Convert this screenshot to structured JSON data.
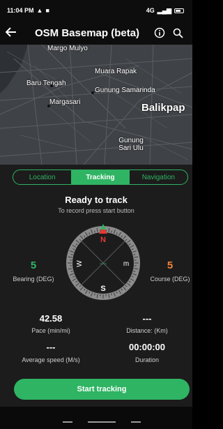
{
  "status_bar": {
    "time": "11:04 PM",
    "network": "4G"
  },
  "app_bar": {
    "back_icon": "arrow-left-icon",
    "title": "OSM Basemap (beta)",
    "info_icon": "info-icon",
    "search_icon": "search-icon"
  },
  "map": {
    "labels": {
      "margo_mulyo": "Margo Mulyo",
      "muara_rapak": "Muara Rapak",
      "baru_tengah": "Baru Tengah",
      "gunung_samarinda": "Gunung Samarinda",
      "margasari": "Margasari",
      "balikpapan": "Balikpap",
      "gunung_sari_ulu": "Gunung Sari Ulu"
    }
  },
  "tabs": [
    {
      "label": "Location",
      "active": false
    },
    {
      "label": "Tracking",
      "active": true
    },
    {
      "label": "Navigation",
      "active": false
    }
  ],
  "tracking": {
    "title": "Ready to track",
    "subtitle": "To record press start button",
    "bearing": {
      "value": "5",
      "label": "Bearing (DEG)",
      "color": "#2fb463"
    },
    "course": {
      "value": "5",
      "label": "Course (DEG)",
      "color": "#f0803c"
    },
    "compass": {
      "north": "N",
      "south": "S",
      "east": "m",
      "west": "W",
      "center": "---",
      "north_color": "#e53935"
    },
    "pace": {
      "value": "42.58",
      "label": "Pace (min/mi)"
    },
    "distance": {
      "value": "---",
      "label": "Distance: (Km)"
    },
    "avg_speed": {
      "value": "---",
      "label": "Average speed (M/s)"
    },
    "duration": {
      "value": "00:00:00",
      "label": "Duration"
    },
    "start_button": "Start tracking"
  },
  "colors": {
    "accent": "#2fb463",
    "panel": "#1c1c1c"
  }
}
